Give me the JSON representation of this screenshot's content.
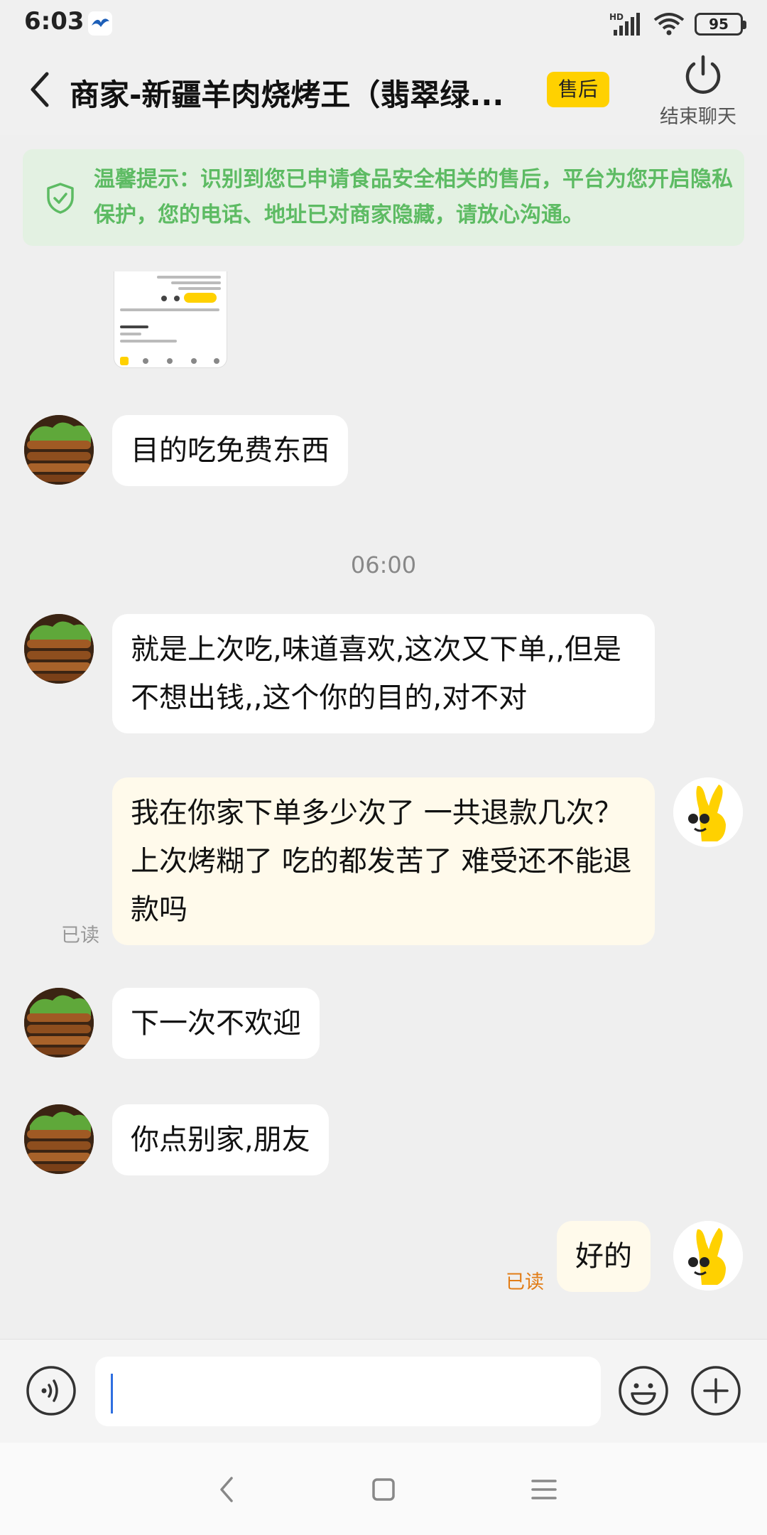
{
  "status_bar": {
    "time": "6:03",
    "network_label": "HD",
    "battery": "95"
  },
  "header": {
    "title": "商家-新疆羊肉烧烤王（翡翠绿...",
    "badge": "售后",
    "end_chat_label": "结束聊天"
  },
  "notice": {
    "text": "温馨提示：识别到您已申请食品安全相关的售后，平台为您开启隐私保护，您的电话、地址已对商家隐藏，请放心沟通。"
  },
  "chat": {
    "messages": [
      {
        "side": "merchant",
        "text": "目的吃免费东西"
      },
      {
        "side": "time",
        "text": "06:00"
      },
      {
        "side": "merchant",
        "text": "就是上次吃,味道喜欢,这次又下单,,但是不想出钱,,这个你的目的,对不对"
      },
      {
        "side": "user",
        "text": "我在你家下单多少次了 一共退款几次？上次烤糊了   吃的都发苦了  难受还不能退款吗",
        "read": "已读"
      },
      {
        "side": "merchant",
        "text": "下一次不欢迎"
      },
      {
        "side": "merchant",
        "text": "你点别家,朋友"
      },
      {
        "side": "user",
        "text": "好的",
        "read": "已读"
      }
    ]
  },
  "input": {
    "placeholder": ""
  },
  "colors": {
    "accent_yellow": "#ffd100",
    "notice_green": "#5dbb63",
    "read_orange": "#e27d17"
  }
}
